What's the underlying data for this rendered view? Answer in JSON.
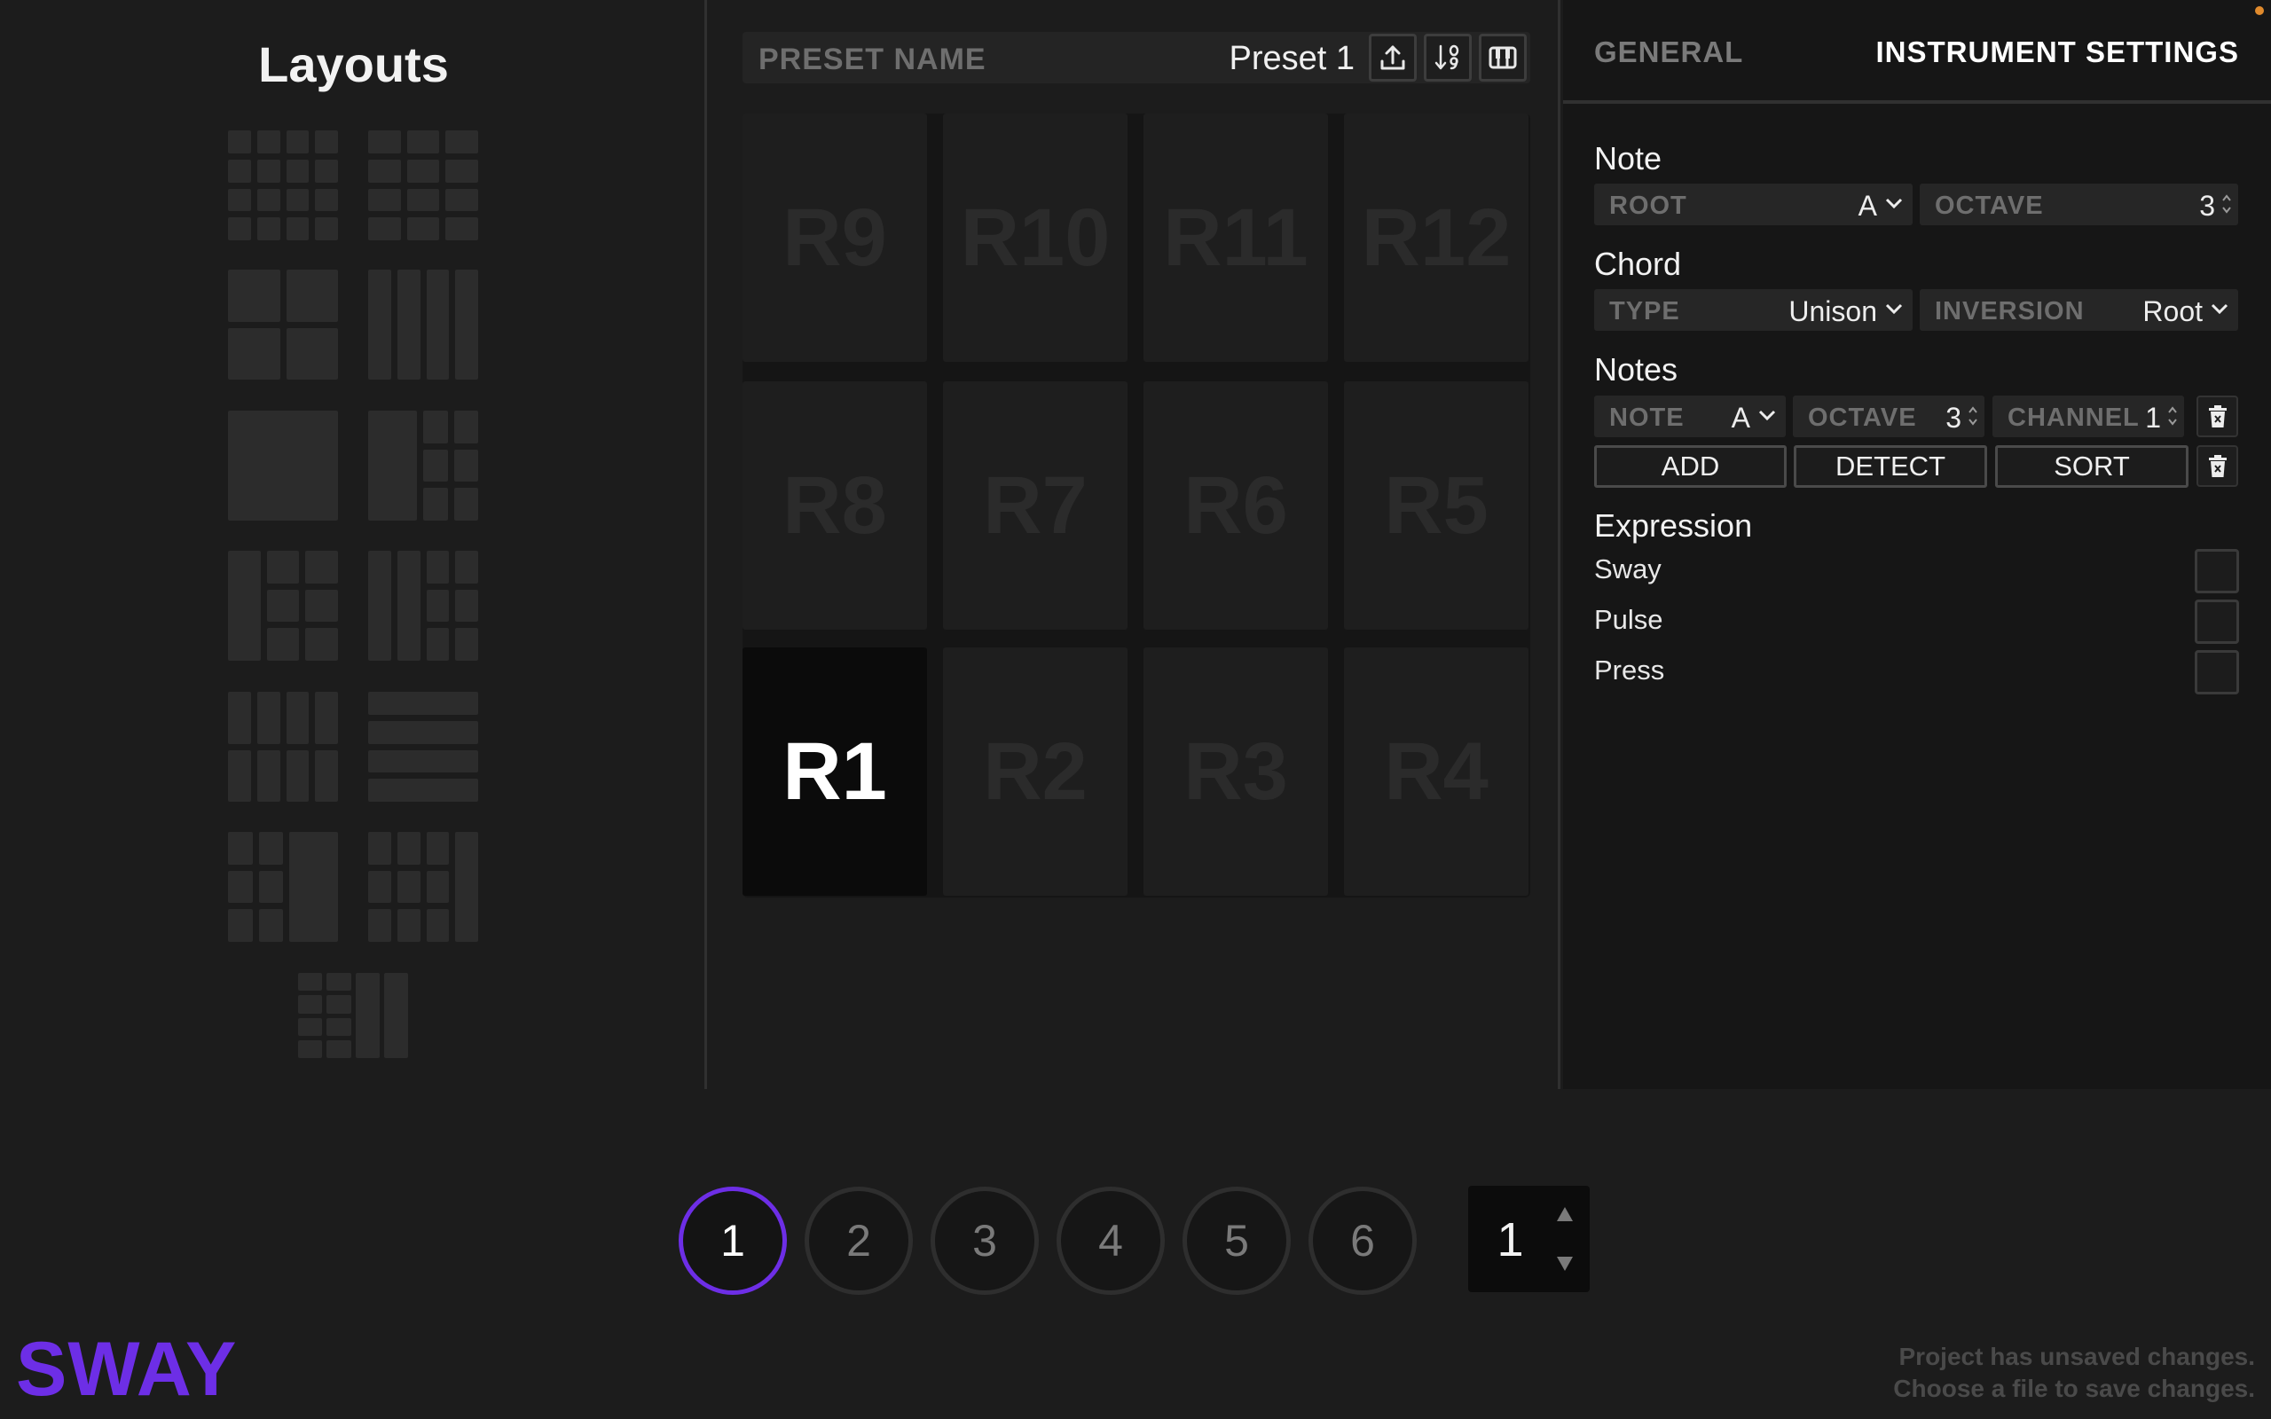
{
  "layouts": {
    "title": "Layouts"
  },
  "preset": {
    "name_label": "PRESET NAME",
    "name_value": "Preset 1",
    "buttons": [
      "upload-icon",
      "sort-numeric-icon",
      "piano-keys-icon"
    ]
  },
  "pads": {
    "rows": [
      [
        "R9",
        "R10",
        "R11",
        "R12"
      ],
      [
        "R8",
        "R7",
        "R6",
        "R5"
      ],
      [
        "R1",
        "R2",
        "R3",
        "R4"
      ]
    ],
    "active": "R1"
  },
  "tabs": {
    "general": "GENERAL",
    "instrument": "INSTRUMENT SETTINGS"
  },
  "note_section": {
    "title": "Note",
    "root_label": "ROOT",
    "root_value": "A",
    "octave_label": "OCTAVE",
    "octave_value": "3"
  },
  "chord_section": {
    "title": "Chord",
    "type_label": "TYPE",
    "type_value": "Unison",
    "inversion_label": "INVERSION",
    "inversion_value": "Root"
  },
  "notes_section": {
    "title": "Notes",
    "note_label": "NOTE",
    "note_value": "A",
    "octave_label": "OCTAVE",
    "octave_value": "3",
    "channel_label": "CHANNEL",
    "channel_value": "1",
    "add_label": "ADD",
    "detect_label": "DETECT",
    "sort_label": "SORT"
  },
  "expression_section": {
    "title": "Expression",
    "items": [
      "Sway",
      "Pulse",
      "Press"
    ]
  },
  "banks": {
    "items": [
      "1",
      "2",
      "3",
      "4",
      "5",
      "6"
    ],
    "active": "1"
  },
  "channel_stepper": {
    "value": "1"
  },
  "footer": {
    "logo": "SWAY",
    "unsaved_line1": "Project has unsaved changes.",
    "unsaved_line2": "Choose a file to save changes."
  },
  "colors": {
    "accent": "#6d2ee6",
    "status_dot": "#e08a2c"
  }
}
